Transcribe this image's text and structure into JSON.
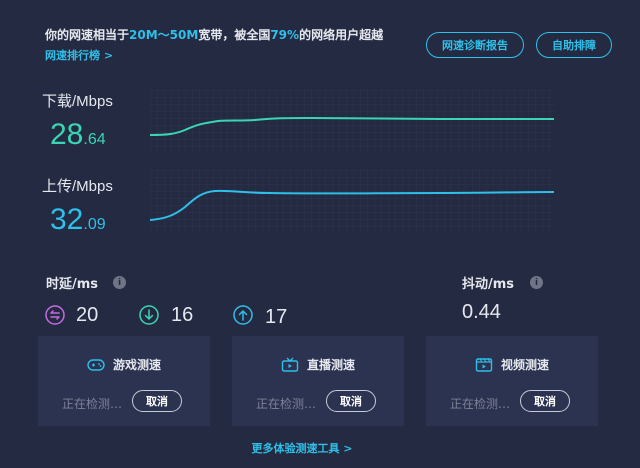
{
  "header": {
    "summary_prefix": "你的网速相当于",
    "summary_range": "20M～50M",
    "summary_mid": "宽带，被全国",
    "summary_percent": "79%",
    "summary_suffix": "的网络用户超越",
    "rank_link": "网速排行榜 >",
    "report_button": "网速诊断报告",
    "self_button": "自助排障"
  },
  "download": {
    "label": "下载/Mbps",
    "value_int": "28",
    "value_dec": ".64",
    "color": "#3ad6b4"
  },
  "upload": {
    "label": "上传/Mbps",
    "value_int": "32",
    "value_dec": ".09",
    "color": "#2fbfe8"
  },
  "latency": {
    "label": "时延/ms",
    "info_icon": "i",
    "items": [
      {
        "icon": "bidirectional-arrows-icon",
        "value": "20",
        "color": "#c46be0"
      },
      {
        "icon": "arrow-down-icon",
        "value": "16",
        "color": "#3ad6b4"
      },
      {
        "icon": "arrow-up-icon",
        "value": "17",
        "color": "#2fbfe8"
      }
    ]
  },
  "jitter": {
    "label": "抖动/ms",
    "info_icon": "i",
    "value": "0.44"
  },
  "cards": [
    {
      "icon": "gamepad-icon",
      "title": "游戏测速",
      "status": "正在检测…",
      "cancel": "取消"
    },
    {
      "icon": "tv-live-icon",
      "title": "直播测速",
      "status": "正在检测…",
      "cancel": "取消"
    },
    {
      "icon": "video-icon",
      "title": "视频测速",
      "status": "正在检测…",
      "cancel": "取消"
    }
  ],
  "footer": {
    "more_link": "更多体验测速工具 >"
  }
}
